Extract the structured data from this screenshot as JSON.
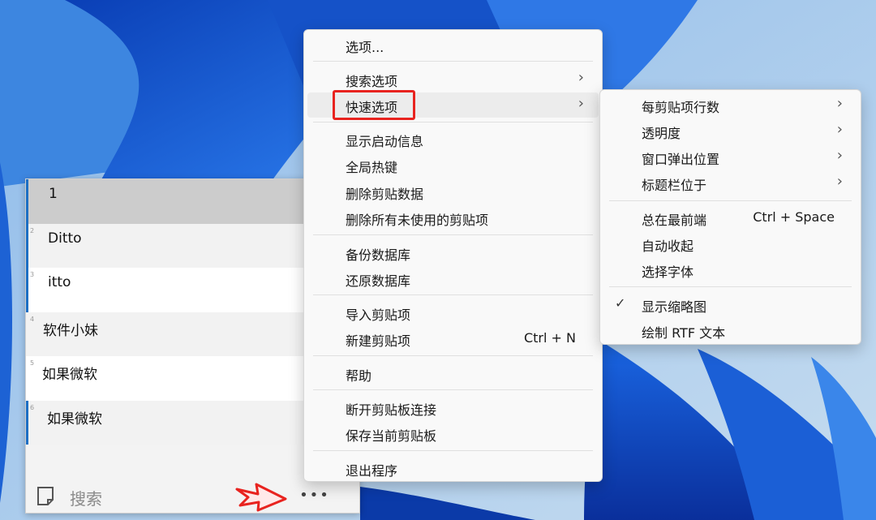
{
  "clips": [
    {
      "index": "",
      "text": "1"
    },
    {
      "index": "2",
      "text": "Ditto"
    },
    {
      "index": "3",
      "text": "itto"
    },
    {
      "index": "4",
      "text": "软件小妹"
    },
    {
      "index": "5",
      "text": "如果微软"
    },
    {
      "index": "6",
      "text": "如果微软"
    }
  ],
  "footer": {
    "search_label": "搜索",
    "more_label": "•••"
  },
  "main_menu": [
    {
      "label": "选项..."
    },
    {
      "label": "搜索选项",
      "submenu": true
    },
    {
      "label": "快速选项",
      "submenu": true,
      "highlighted": true,
      "callout": true
    },
    {
      "label": "显示启动信息"
    },
    {
      "label": "全局热键"
    },
    {
      "label": "删除剪贴数据"
    },
    {
      "label": "删除所有未使用的剪贴项"
    },
    {
      "label": "备份数据库"
    },
    {
      "label": "还原数据库"
    },
    {
      "label": "导入剪贴项"
    },
    {
      "label": "新建剪贴项",
      "shortcut": "Ctrl + N"
    },
    {
      "label": "帮助"
    },
    {
      "label": "断开剪贴板连接"
    },
    {
      "label": "保存当前剪贴板"
    },
    {
      "label": "退出程序"
    }
  ],
  "sub_menu": [
    {
      "label": "每剪贴项行数",
      "submenu": true
    },
    {
      "label": "透明度",
      "submenu": true
    },
    {
      "label": "窗口弹出位置",
      "submenu": true
    },
    {
      "label": "标题栏位于",
      "submenu": true
    },
    {
      "label": "总在最前端",
      "shortcut": "Ctrl + Space"
    },
    {
      "label": "自动收起"
    },
    {
      "label": "选择字体"
    },
    {
      "label": "显示缩略图",
      "checked": true
    },
    {
      "label": "绘制 RTF 文本"
    }
  ],
  "colors": {
    "accent": "#1c6fc4",
    "callout": "#e8231f",
    "selected_row": "#cccccc"
  }
}
